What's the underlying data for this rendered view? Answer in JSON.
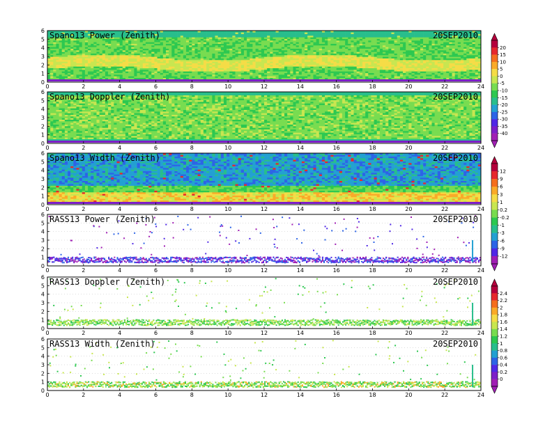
{
  "figure": {
    "date_label": "20SEP2010"
  },
  "chart_data": [
    {
      "type": "heatmap",
      "title": "Spano13 Power (Zenith)",
      "date": "20SEP2010",
      "x_range": [
        0,
        24
      ],
      "x_ticks": [
        0,
        2,
        4,
        6,
        8,
        10,
        12,
        14,
        16,
        18,
        20,
        22,
        24
      ],
      "y_range": [
        0,
        6
      ],
      "y_ticks": [
        0,
        1,
        2,
        3,
        4,
        5,
        6
      ],
      "colorbar_group": "power",
      "description_values": {
        "dominant_levels": "-15 to -5",
        "band_height_range": [
          1.5,
          3
        ]
      }
    },
    {
      "type": "heatmap",
      "title": "Spano13 Doppler (Zenith)",
      "date": "20SEP2010",
      "x_range": [
        0,
        24
      ],
      "x_ticks": [
        0,
        2,
        4,
        6,
        8,
        10,
        12,
        14,
        16,
        18,
        20,
        22,
        24
      ],
      "y_range": [
        0,
        6
      ],
      "y_ticks": [
        0,
        1,
        2,
        3,
        4,
        5,
        6
      ],
      "colorbar_group": "power"
    },
    {
      "type": "heatmap",
      "title": "Spano13 Width (Zenith)",
      "date": "20SEP2010",
      "x_range": [
        0,
        24
      ],
      "x_ticks": [
        0,
        2,
        4,
        6,
        8,
        10,
        12,
        14,
        16,
        18,
        20,
        22,
        24
      ],
      "y_range": [
        0,
        6
      ],
      "y_ticks": [
        0,
        1,
        2,
        3,
        4,
        5,
        6
      ],
      "colorbar_group": "width"
    },
    {
      "type": "scatter",
      "title": "RASS13 Power (Zenith)",
      "date": "20SEP2010",
      "x_range": [
        0,
        24
      ],
      "x_ticks": [
        0,
        2,
        4,
        6,
        8,
        10,
        12,
        14,
        16,
        18,
        20,
        22,
        24
      ],
      "y_range": [
        0,
        6
      ],
      "y_ticks": [
        0,
        1,
        2,
        3,
        4,
        5,
        6
      ],
      "colorbar_group": "width"
    },
    {
      "type": "scatter",
      "title": "RASS13 Doppler (Zenith)",
      "date": "20SEP2010",
      "x_range": [
        0,
        24
      ],
      "x_ticks": [
        0,
        2,
        4,
        6,
        8,
        10,
        12,
        14,
        16,
        18,
        20,
        22,
        24
      ],
      "y_range": [
        0,
        6
      ],
      "y_ticks": [
        0,
        1,
        2,
        3,
        4,
        5,
        6
      ],
      "colorbar_group": "doppler"
    },
    {
      "type": "scatter",
      "title": "RASS13 Width (Zenith)",
      "date": "20SEP2010",
      "x_range": [
        0,
        24
      ],
      "x_ticks": [
        0,
        2,
        4,
        6,
        8,
        10,
        12,
        14,
        16,
        18,
        20,
        22,
        24
      ],
      "y_range": [
        0,
        6
      ],
      "y_ticks": [
        0,
        1,
        2,
        3,
        4,
        5,
        6
      ],
      "colorbar_group": "doppler"
    }
  ],
  "colorbars": {
    "power": {
      "levels": [
        "20",
        "15",
        "10",
        "5",
        "0",
        "-5",
        "-10",
        "-15",
        "-20",
        "-25",
        "-30",
        "-35",
        "-40"
      ],
      "colors": [
        "#b4003c",
        "#e6282d",
        "#f56e1e",
        "#faaa28",
        "#f5dc46",
        "#c8e650",
        "#78dc50",
        "#2dc850",
        "#28be8c",
        "#23a0d2",
        "#2d64e6",
        "#5028e6",
        "#7d1ec8",
        "#a01eb4"
      ]
    },
    "width": {
      "levels": [
        "12",
        "9",
        "6",
        "3",
        "1",
        "0.2",
        "-0.2",
        "-1",
        "-3",
        "-6",
        "-9",
        "-12"
      ],
      "colors": [
        "#b4003c",
        "#e6282d",
        "#f56e1e",
        "#faaa28",
        "#f5dc46",
        "#c8e650",
        "#78dc50",
        "#2dc850",
        "#28be8c",
        "#23a0d2",
        "#2d64e6",
        "#5028e6",
        "#a01eb4"
      ]
    },
    "doppler": {
      "levels": [
        "2.4",
        "2.2",
        "2",
        "1.8",
        "1.6",
        "1.4",
        "1.2",
        "1",
        "0.8",
        "0.6",
        "0.4",
        "0.2",
        "0"
      ],
      "colors": [
        "#b4003c",
        "#e6282d",
        "#f56e1e",
        "#faaa28",
        "#f5dc46",
        "#c8e650",
        "#78dc50",
        "#2dc850",
        "#28be8c",
        "#23a0d2",
        "#2d64e6",
        "#5028e6",
        "#7d1ec8",
        "#a01eb4"
      ]
    }
  }
}
